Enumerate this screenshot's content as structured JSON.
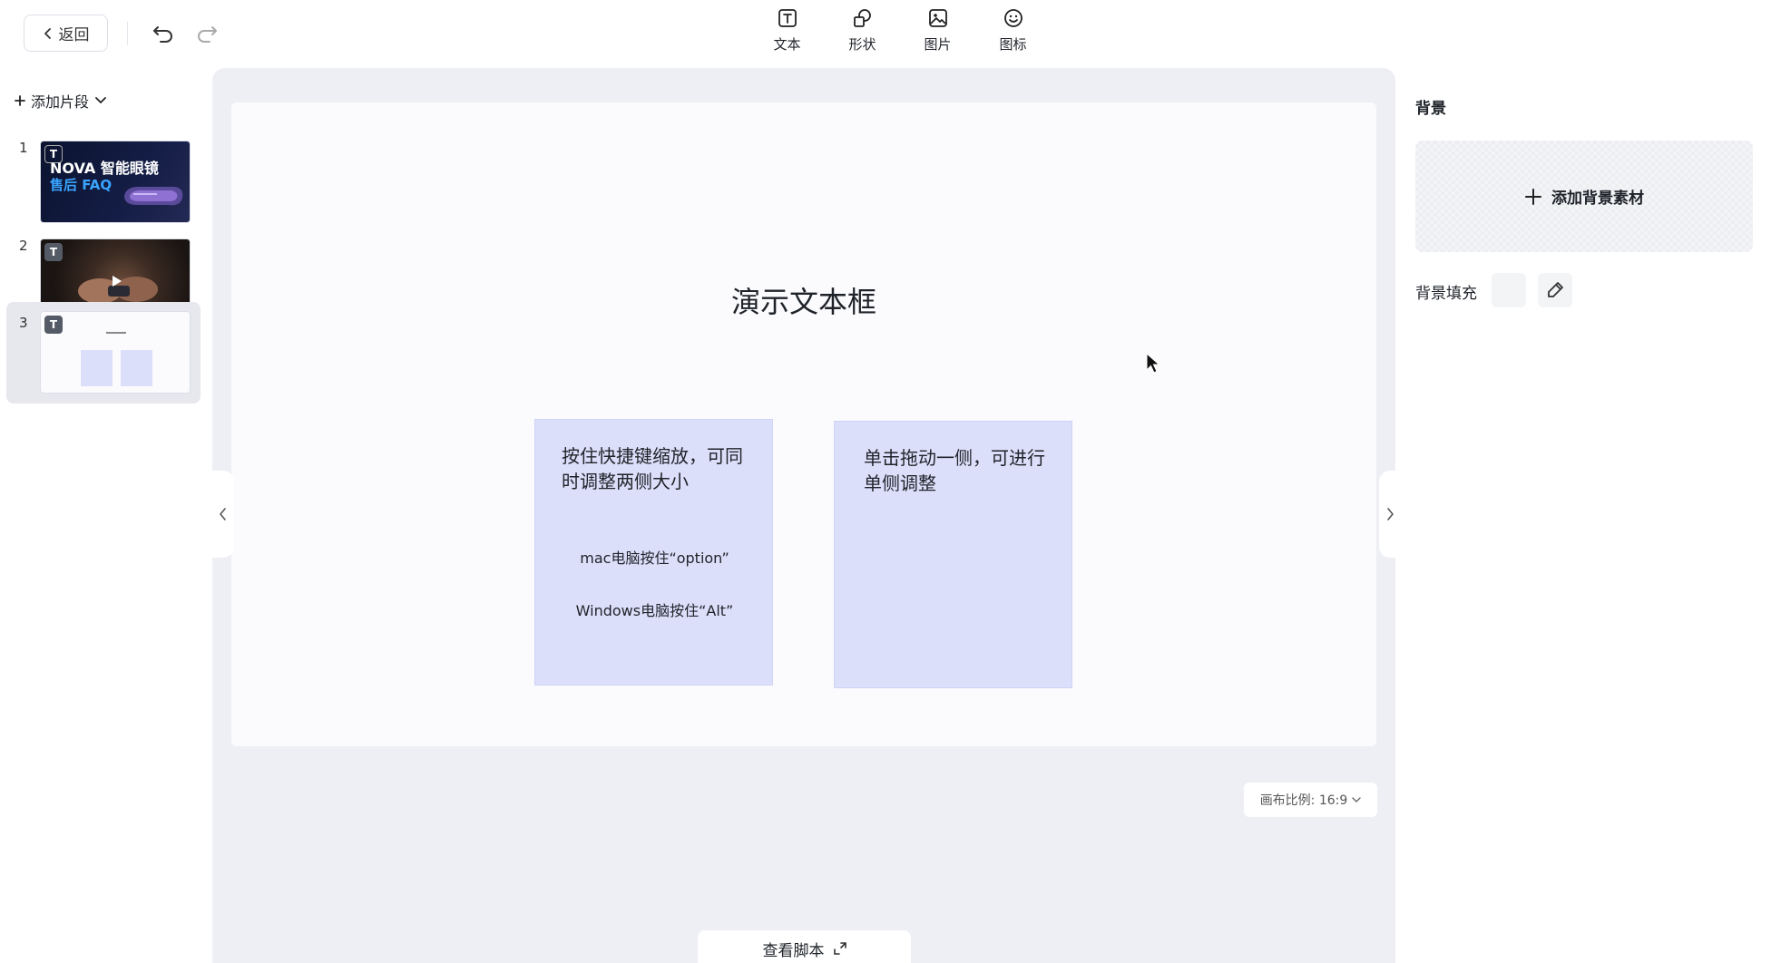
{
  "header": {
    "back_label": "返回",
    "tools": [
      {
        "label": "文本",
        "icon": "text-icon"
      },
      {
        "label": "形状",
        "icon": "shape-icon"
      },
      {
        "label": "图片",
        "icon": "image-icon"
      },
      {
        "label": "图标",
        "icon": "emoji-icon"
      }
    ]
  },
  "sidebar": {
    "add_segment_label": "添加片段",
    "slides": [
      {
        "number": "1",
        "badge": "T",
        "title_line1": "NOVA 智能眼镜",
        "title_line2": "售后 FAQ"
      },
      {
        "number": "2",
        "badge": "T"
      },
      {
        "number": "3",
        "badge": "T",
        "active": true
      }
    ]
  },
  "canvas": {
    "title": "演示文本框",
    "box_a": {
      "heading": "按住快捷键缩放，可同时调整两侧大小",
      "line1": "mac电脑按住“option”",
      "line2": "Windows电脑按住“Alt”"
    },
    "box_b": {
      "heading": "单击拖动一侧，可进行单侧调整"
    },
    "ratio_label": "画布比例: 16:9",
    "script_label": "查看脚本"
  },
  "right_panel": {
    "section_title": "背景",
    "add_bg_label": "添加背景素材",
    "fill_label": "背景填充"
  },
  "colors": {
    "workspace_bg": "#eeeff5",
    "box_fill": "#dcdffa",
    "active_slide_bg": "#e7e8ee"
  }
}
